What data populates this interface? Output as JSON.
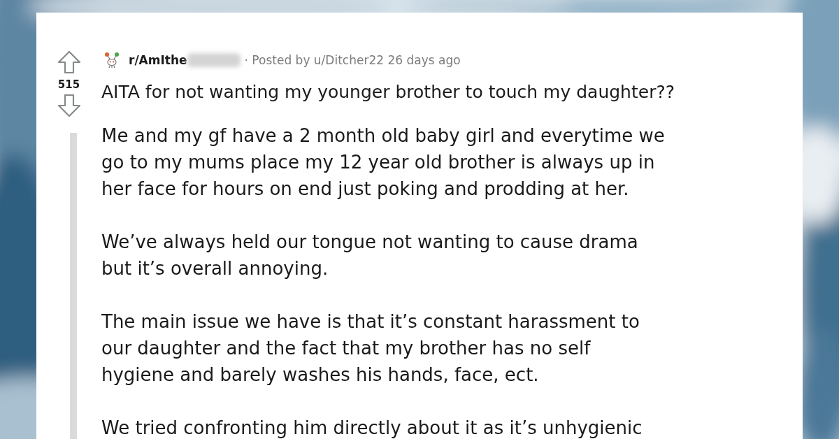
{
  "post": {
    "votes": "515",
    "subreddit": "r/AmIthe",
    "meta": "· Posted by u/Ditcher22 26 days ago",
    "title": "AITA for not wanting my younger brother to touch my daughter??",
    "paragraphs": [
      {
        "lines": [
          "Me and my gf have a 2 month old baby girl and everytime we",
          "go to my mums place my 12 year old brother is always up in",
          "her face for hours on end just poking and prodding at her."
        ]
      },
      {
        "lines": [
          "We’ve always held our tongue not wanting to cause drama",
          "but it’s overall annoying."
        ]
      },
      {
        "lines": [
          "The main issue we have is that it’s constant harassment to",
          "our daughter and the fact that my brother has no self",
          "hygiene and barely washes his hands, face, ect."
        ]
      },
      {
        "lines": [
          "We tried confronting him directly about it as it’s unhygienic"
        ]
      }
    ]
  }
}
